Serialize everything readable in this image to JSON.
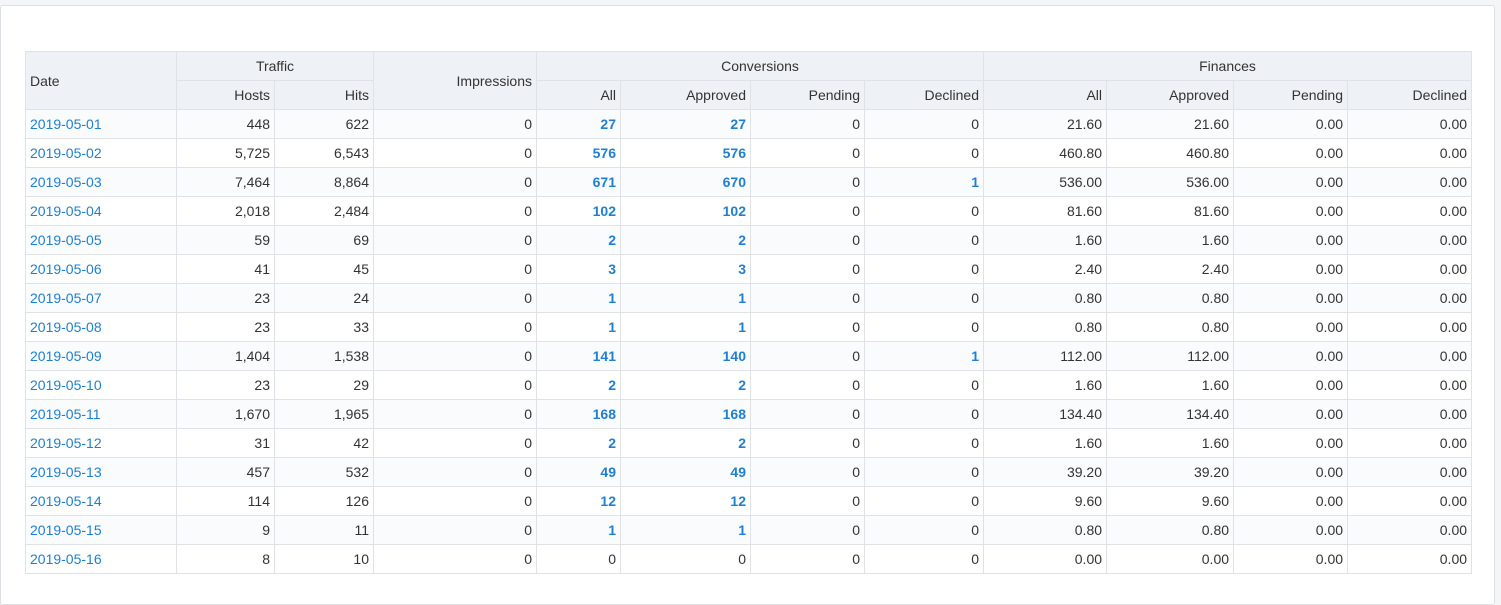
{
  "headers": {
    "date": "Date",
    "traffic": "Traffic",
    "hosts": "Hosts",
    "hits": "Hits",
    "impressions": "Impressions",
    "conversions": "Conversions",
    "conv_all": "All",
    "conv_approved": "Approved",
    "conv_pending": "Pending",
    "conv_declined": "Declined",
    "finances": "Finances",
    "fin_all": "All",
    "fin_approved": "Approved",
    "fin_pending": "Pending",
    "fin_declined": "Declined"
  },
  "rows": [
    {
      "date": "2019-05-01",
      "hosts": "448",
      "hits": "622",
      "impressions": "0",
      "conv_all": "27",
      "conv_approved": "27",
      "conv_pending": "0",
      "conv_declined": "0",
      "fin_all": "21.60",
      "fin_approved": "21.60",
      "fin_pending": "0.00",
      "fin_declined": "0.00"
    },
    {
      "date": "2019-05-02",
      "hosts": "5,725",
      "hits": "6,543",
      "impressions": "0",
      "conv_all": "576",
      "conv_approved": "576",
      "conv_pending": "0",
      "conv_declined": "0",
      "fin_all": "460.80",
      "fin_approved": "460.80",
      "fin_pending": "0.00",
      "fin_declined": "0.00"
    },
    {
      "date": "2019-05-03",
      "hosts": "7,464",
      "hits": "8,864",
      "impressions": "0",
      "conv_all": "671",
      "conv_approved": "670",
      "conv_pending": "0",
      "conv_declined": "1",
      "fin_all": "536.00",
      "fin_approved": "536.00",
      "fin_pending": "0.00",
      "fin_declined": "0.00"
    },
    {
      "date": "2019-05-04",
      "hosts": "2,018",
      "hits": "2,484",
      "impressions": "0",
      "conv_all": "102",
      "conv_approved": "102",
      "conv_pending": "0",
      "conv_declined": "0",
      "fin_all": "81.60",
      "fin_approved": "81.60",
      "fin_pending": "0.00",
      "fin_declined": "0.00"
    },
    {
      "date": "2019-05-05",
      "hosts": "59",
      "hits": "69",
      "impressions": "0",
      "conv_all": "2",
      "conv_approved": "2",
      "conv_pending": "0",
      "conv_declined": "0",
      "fin_all": "1.60",
      "fin_approved": "1.60",
      "fin_pending": "0.00",
      "fin_declined": "0.00"
    },
    {
      "date": "2019-05-06",
      "hosts": "41",
      "hits": "45",
      "impressions": "0",
      "conv_all": "3",
      "conv_approved": "3",
      "conv_pending": "0",
      "conv_declined": "0",
      "fin_all": "2.40",
      "fin_approved": "2.40",
      "fin_pending": "0.00",
      "fin_declined": "0.00"
    },
    {
      "date": "2019-05-07",
      "hosts": "23",
      "hits": "24",
      "impressions": "0",
      "conv_all": "1",
      "conv_approved": "1",
      "conv_pending": "0",
      "conv_declined": "0",
      "fin_all": "0.80",
      "fin_approved": "0.80",
      "fin_pending": "0.00",
      "fin_declined": "0.00"
    },
    {
      "date": "2019-05-08",
      "hosts": "23",
      "hits": "33",
      "impressions": "0",
      "conv_all": "1",
      "conv_approved": "1",
      "conv_pending": "0",
      "conv_declined": "0",
      "fin_all": "0.80",
      "fin_approved": "0.80",
      "fin_pending": "0.00",
      "fin_declined": "0.00"
    },
    {
      "date": "2019-05-09",
      "hosts": "1,404",
      "hits": "1,538",
      "impressions": "0",
      "conv_all": "141",
      "conv_approved": "140",
      "conv_pending": "0",
      "conv_declined": "1",
      "fin_all": "112.00",
      "fin_approved": "112.00",
      "fin_pending": "0.00",
      "fin_declined": "0.00"
    },
    {
      "date": "2019-05-10",
      "hosts": "23",
      "hits": "29",
      "impressions": "0",
      "conv_all": "2",
      "conv_approved": "2",
      "conv_pending": "0",
      "conv_declined": "0",
      "fin_all": "1.60",
      "fin_approved": "1.60",
      "fin_pending": "0.00",
      "fin_declined": "0.00"
    },
    {
      "date": "2019-05-11",
      "hosts": "1,670",
      "hits": "1,965",
      "impressions": "0",
      "conv_all": "168",
      "conv_approved": "168",
      "conv_pending": "0",
      "conv_declined": "0",
      "fin_all": "134.40",
      "fin_approved": "134.40",
      "fin_pending": "0.00",
      "fin_declined": "0.00"
    },
    {
      "date": "2019-05-12",
      "hosts": "31",
      "hits": "42",
      "impressions": "0",
      "conv_all": "2",
      "conv_approved": "2",
      "conv_pending": "0",
      "conv_declined": "0",
      "fin_all": "1.60",
      "fin_approved": "1.60",
      "fin_pending": "0.00",
      "fin_declined": "0.00"
    },
    {
      "date": "2019-05-13",
      "hosts": "457",
      "hits": "532",
      "impressions": "0",
      "conv_all": "49",
      "conv_approved": "49",
      "conv_pending": "0",
      "conv_declined": "0",
      "fin_all": "39.20",
      "fin_approved": "39.20",
      "fin_pending": "0.00",
      "fin_declined": "0.00"
    },
    {
      "date": "2019-05-14",
      "hosts": "114",
      "hits": "126",
      "impressions": "0",
      "conv_all": "12",
      "conv_approved": "12",
      "conv_pending": "0",
      "conv_declined": "0",
      "fin_all": "9.60",
      "fin_approved": "9.60",
      "fin_pending": "0.00",
      "fin_declined": "0.00"
    },
    {
      "date": "2019-05-15",
      "hosts": "9",
      "hits": "11",
      "impressions": "0",
      "conv_all": "1",
      "conv_approved": "1",
      "conv_pending": "0",
      "conv_declined": "0",
      "fin_all": "0.80",
      "fin_approved": "0.80",
      "fin_pending": "0.00",
      "fin_declined": "0.00"
    },
    {
      "date": "2019-05-16",
      "hosts": "8",
      "hits": "10",
      "impressions": "0",
      "conv_all": "0",
      "conv_approved": "0",
      "conv_pending": "0",
      "conv_declined": "0",
      "fin_all": "0.00",
      "fin_approved": "0.00",
      "fin_pending": "0.00",
      "fin_declined": "0.00"
    }
  ],
  "colors": {
    "link": "#1f7fd0",
    "header_bg": "#eef1f5",
    "border": "#dfe2e6"
  }
}
